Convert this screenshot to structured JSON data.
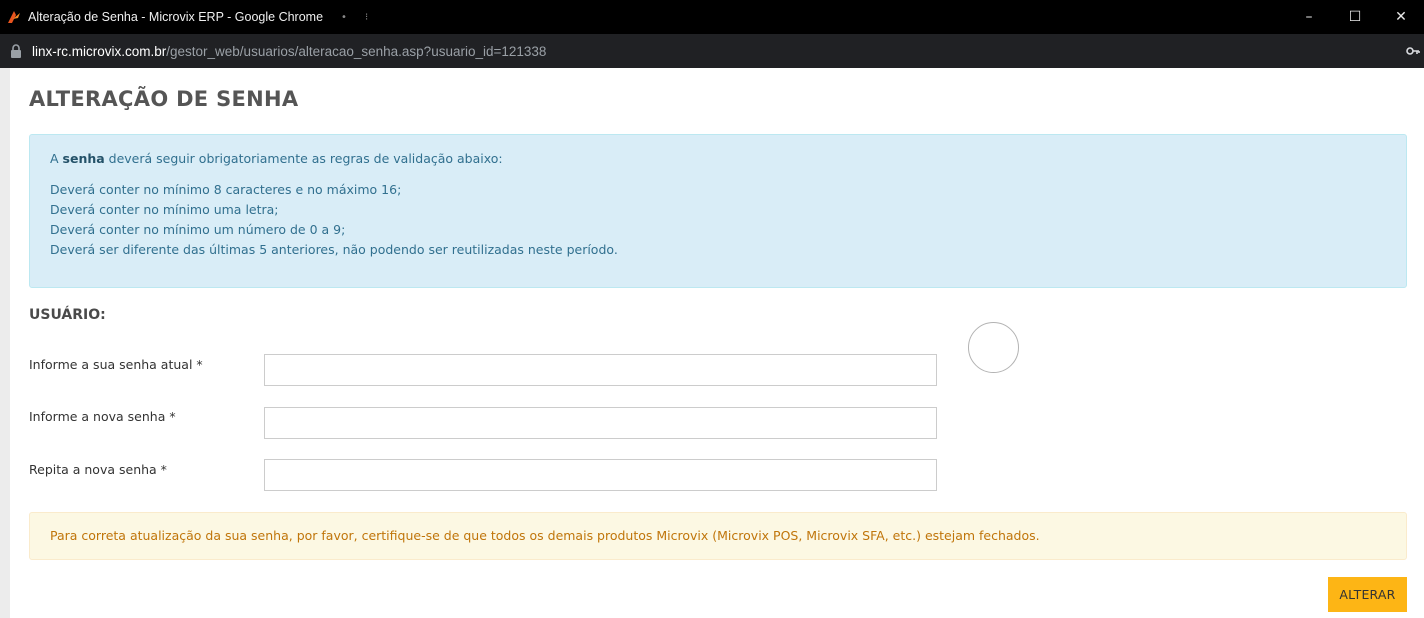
{
  "window": {
    "title": "Alteração de Senha - Microvix ERP - Google Chrome",
    "minimize_label": "–",
    "maximize_label": "☐",
    "close_label": "✕"
  },
  "address_bar": {
    "host": "linx-rc.microvix.com.br",
    "path": "/gestor_web/usuarios/alteracao_senha.asp?usuario_id=121338"
  },
  "page": {
    "title": "ALTERAÇÃO DE SENHA",
    "info": {
      "intro_prefix": "A ",
      "intro_bold": "senha",
      "intro_suffix": " deverá seguir obrigatoriamente as regras de validação abaixo:",
      "rules": [
        "Deverá conter no mínimo 8 caracteres e no máximo 16;",
        "Deverá conter no mínimo uma letra;",
        "Deverá conter no mínimo um número de 0 a 9;",
        "Deverá ser diferente das últimas 5 anteriores, não podendo ser reutilizadas neste período."
      ]
    },
    "user_label": "USUÁRIO:",
    "user_value": "",
    "fields": {
      "current_password_label": "Informe a sua senha atual *",
      "new_password_label": "Informe a nova senha *",
      "repeat_password_label": "Repita a nova senha *",
      "current_password_value": "",
      "new_password_value": "",
      "repeat_password_value": ""
    },
    "warning": "Para correta atualização da sua senha, por favor, certifique-se de que todos os demais produtos Microvix (Microvix POS, Microvix SFA, etc.) estejam fechados.",
    "submit_label": "ALTERAR"
  },
  "colors": {
    "info_bg": "#d9edf7",
    "info_text": "#31708f",
    "warning_bg": "#fcf8e3",
    "warning_text": "#c0750a",
    "button_bg": "#fdb515"
  }
}
